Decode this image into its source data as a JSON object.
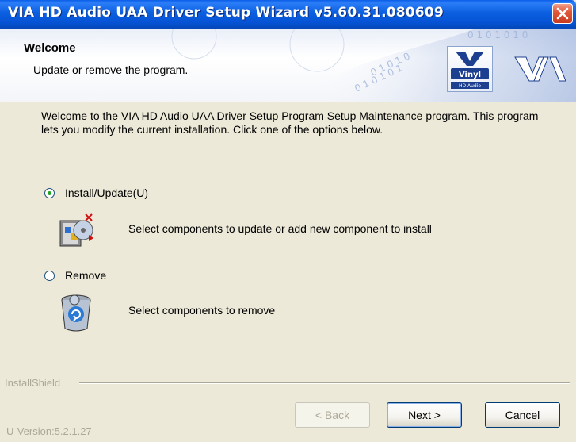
{
  "window": {
    "title": "VIA HD Audio UAA Driver Setup Wizard v5.60.31.080609"
  },
  "header": {
    "title": "Welcome",
    "subtitle": "Update or remove the program.",
    "logo_vinyl_text": "Vinyl",
    "logo_vinyl_sub": "HD Audio",
    "logo_via_text": "VIA"
  },
  "body": {
    "intro": "Welcome to the VIA HD Audio UAA Driver Setup Program Setup Maintenance program. This program lets you modify the current installation. Click one of the options below.",
    "options": [
      {
        "label": "Install/Update(U)",
        "description": "Select components to update or add new component to install",
        "selected": true,
        "icon": "install-update-icon"
      },
      {
        "label": "Remove",
        "description": "Select components to remove",
        "selected": false,
        "icon": "remove-icon"
      }
    ]
  },
  "footer": {
    "brand": "InstallShield",
    "version": "U-Version:5.2.1.27",
    "back_label": "< Back",
    "next_label": "Next >",
    "cancel_label": "Cancel"
  }
}
